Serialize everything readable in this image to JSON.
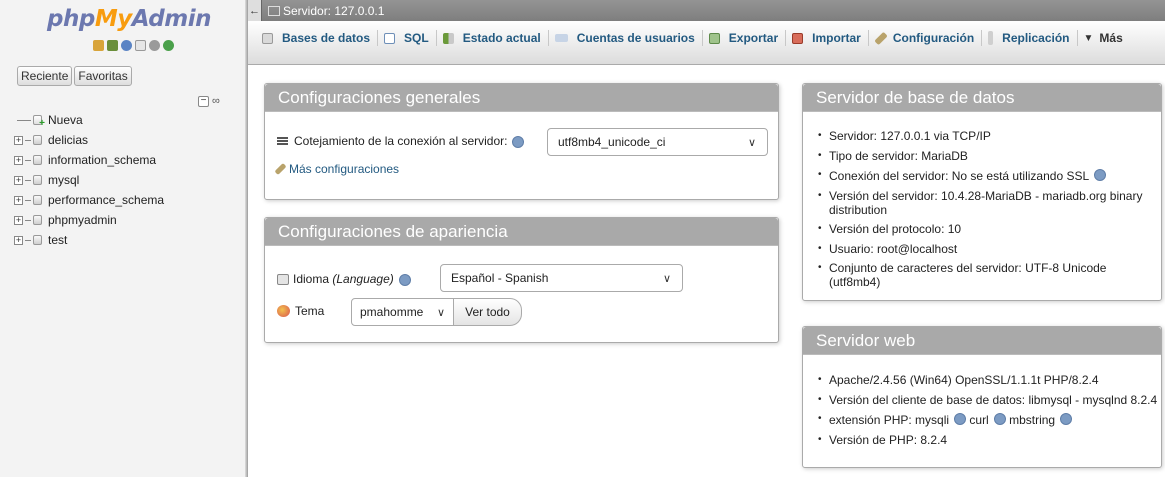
{
  "nav": {
    "logo_php": "php",
    "logo_my": "My",
    "logo_admin": "Admin",
    "tabs": [
      "Reciente",
      "Favoritas"
    ],
    "collapse_link": "∞",
    "tree": [
      {
        "label": "Nueva"
      },
      {
        "label": "delicias"
      },
      {
        "label": "information_schema"
      },
      {
        "label": "mysql"
      },
      {
        "label": "performance_schema"
      },
      {
        "label": "phpmyadmin"
      },
      {
        "label": "test"
      }
    ]
  },
  "serverbar": {
    "text": "Servidor: 127.0.0.1"
  },
  "menu": {
    "tabs": [
      {
        "label": "Bases de datos",
        "icon": "database-icon"
      },
      {
        "label": "SQL",
        "icon": "sql-icon"
      },
      {
        "label": "Estado actual",
        "icon": "status-icon"
      },
      {
        "label": "Cuentas de usuarios",
        "icon": "users-icon"
      },
      {
        "label": "Exportar",
        "icon": "export-icon"
      },
      {
        "label": "Importar",
        "icon": "import-icon"
      },
      {
        "label": "Configuración",
        "icon": "wrench-icon"
      },
      {
        "label": "Replicación",
        "icon": "replication-icon"
      },
      {
        "label": "Más",
        "icon": "chevron-down-icon"
      }
    ]
  },
  "general": {
    "title": "Configuraciones generales",
    "collation_label": "Cotejamiento de la conexión al servidor:",
    "collation_value": "utf8mb4_unicode_ci",
    "more_settings": "Más configuraciones"
  },
  "appearance": {
    "title": "Configuraciones de apariencia",
    "language_label": "Idioma",
    "language_hint": "(Language)",
    "language_value": "Español - Spanish",
    "theme_label": "Tema",
    "theme_value": "pmahomme",
    "view_all": "Ver todo"
  },
  "dbserver": {
    "title": "Servidor de base de datos",
    "items": [
      "Servidor: 127.0.0.1 via TCP/IP",
      "Tipo de servidor: MariaDB",
      "Conexión del servidor: No se está utilizando SSL",
      "Versión del servidor: 10.4.28-MariaDB - mariadb.org binary distribution",
      "Versión del protocolo: 10",
      "Usuario: root@localhost",
      "Conjunto de caracteres del servidor: UTF-8 Unicode (utf8mb4)"
    ]
  },
  "webserver": {
    "title": "Servidor web",
    "items": [
      "Apache/2.4.56 (Win64) OpenSSL/1.1.1t PHP/8.2.4",
      "Versión del cliente de base de datos: libmysql - mysqlnd 8.2.4",
      "extensión PHP: mysqli",
      "curl",
      "mbstring",
      "Versión de PHP: 8.2.4"
    ]
  }
}
